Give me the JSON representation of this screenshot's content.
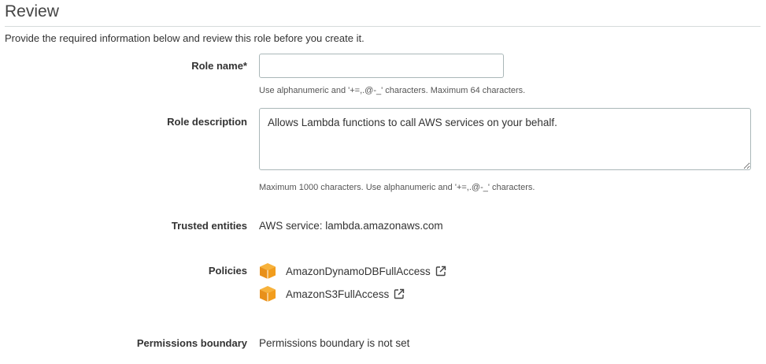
{
  "header": {
    "title": "Review",
    "intro": "Provide the required information below and review this role before you create it."
  },
  "role_name": {
    "label": "Role name*",
    "value": "",
    "hint": "Use alphanumeric and '+=,.@-_' characters. Maximum 64 characters."
  },
  "role_description": {
    "label": "Role description",
    "value": "Allows Lambda functions to call AWS services on your behalf.",
    "hint": "Maximum 1000 characters. Use alphanumeric and '+=,.@-_' characters."
  },
  "trusted_entities": {
    "label": "Trusted entities",
    "value": "AWS service: lambda.amazonaws.com"
  },
  "policies": {
    "label": "Policies",
    "items": [
      {
        "name": "AmazonDynamoDBFullAccess",
        "icon": "aws-policy-cube-icon"
      },
      {
        "name": "AmazonS3FullAccess",
        "icon": "aws-policy-cube-icon"
      }
    ],
    "icon_color": "#f7a81b"
  },
  "permissions_boundary": {
    "label": "Permissions boundary",
    "value": "Permissions boundary is not set"
  }
}
